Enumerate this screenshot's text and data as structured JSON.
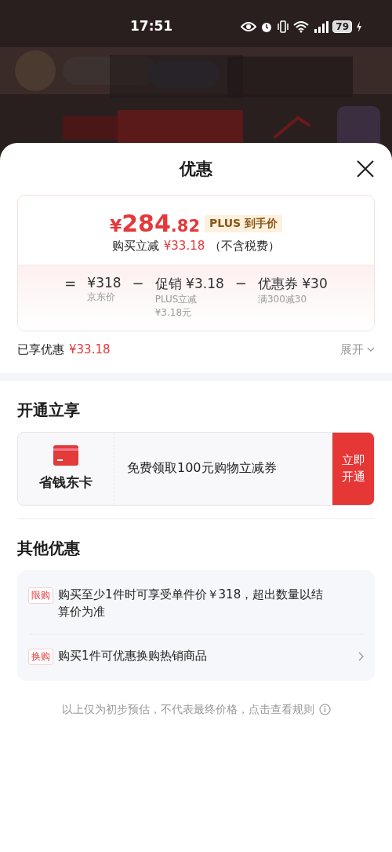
{
  "status_bar": {
    "time": "17:51",
    "battery": "79"
  },
  "sheet": {
    "title": "优惠",
    "summary": {
      "currency": "¥",
      "price_int": "284",
      "price_dec": ".82",
      "badge": "PLUS 到手价",
      "saving_label": "购买立减",
      "saving_value": "¥33.18",
      "saving_note": "（不含税费）",
      "breakdown": [
        {
          "kind": "op",
          "text": "="
        },
        {
          "kind": "term",
          "value": "¥318",
          "notes": [
            "京东价"
          ]
        },
        {
          "kind": "op",
          "text": "−"
        },
        {
          "kind": "term",
          "value": "促销 ¥3.18",
          "notes": [
            "PLUS立减",
            "¥3.18元"
          ]
        },
        {
          "kind": "op",
          "text": "−"
        },
        {
          "kind": "term",
          "value": "优惠券 ¥30",
          "notes": [
            "满300减30"
          ]
        }
      ]
    },
    "enjoyed": {
      "label": "已享优惠",
      "value": "¥33.18",
      "toggle": "展开",
      "expanded": false
    },
    "open_section": {
      "title": "开通立享",
      "card": {
        "name": "省钱东卡",
        "desc": "免费领取100元购物立减券",
        "button": "立即开通"
      }
    },
    "other_section": {
      "title": "其他优惠",
      "items": [
        {
          "tag": "限购",
          "text": "购买至少1件时可享受单件价￥318，超出数量以结算价为准",
          "has_arrow": false
        },
        {
          "tag": "换购",
          "text": "购买1件可优惠换购热销商品",
          "has_arrow": true
        }
      ]
    },
    "footnote": "以上仅为初步预估，不代表最终价格，点击查看规则"
  }
}
